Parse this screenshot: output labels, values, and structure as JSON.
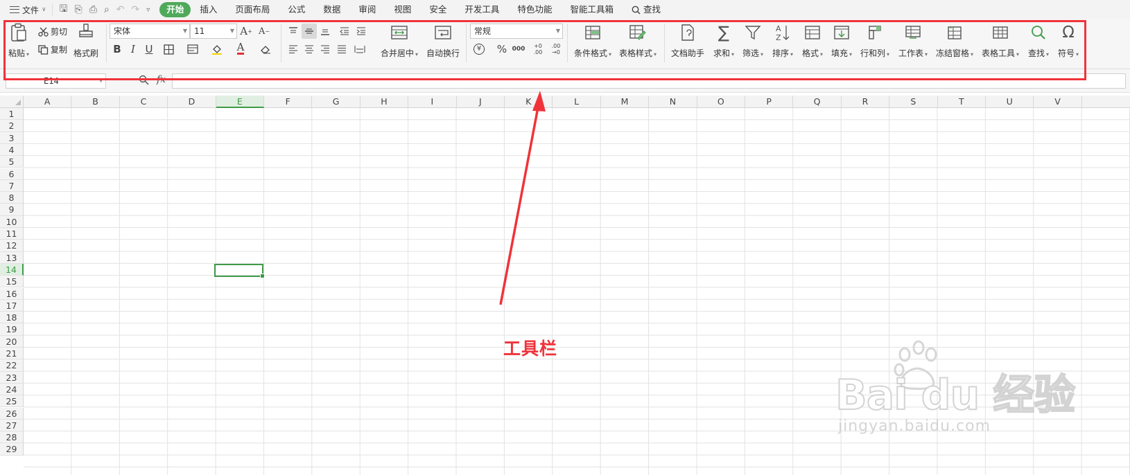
{
  "menubar": {
    "file_label": "文件",
    "tabs": [
      "开始",
      "插入",
      "页面布局",
      "公式",
      "数据",
      "审阅",
      "视图",
      "安全",
      "开发工具",
      "特色功能",
      "智能工具箱"
    ],
    "search_label": "查找"
  },
  "ribbon": {
    "clipboard": {
      "paste": "粘贴",
      "cut": "剪切",
      "copy": "复制",
      "format_painter": "格式刷"
    },
    "font": {
      "font_name": "宋体",
      "font_size": "11",
      "bold": "B",
      "italic": "I",
      "underline": "U",
      "font_color_glyph": "A"
    },
    "alignment": {
      "merge_center": "合并居中",
      "wrap_text": "自动换行"
    },
    "number": {
      "format": "常规",
      "percent": "%",
      "thousands": "000",
      "inc_decimal": "+0 .00",
      "dec_decimal": ".00 →0"
    },
    "styles": {
      "conditional_format": "条件格式",
      "table_style": "表格样式"
    },
    "tools": [
      "文档助手",
      "求和",
      "筛选",
      "排序",
      "格式",
      "填充",
      "行和列",
      "工作表",
      "冻结窗格",
      "表格工具",
      "查找",
      "符号"
    ]
  },
  "formula_bar": {
    "name_box": "E14",
    "fx": "fx",
    "value": ""
  },
  "sheet": {
    "columns": [
      "A",
      "B",
      "C",
      "D",
      "E",
      "F",
      "G",
      "H",
      "I",
      "J",
      "K",
      "L",
      "M",
      "N",
      "O",
      "P",
      "Q",
      "R",
      "S",
      "T",
      "U",
      "V"
    ],
    "rows": [
      "1",
      "2",
      "3",
      "4",
      "5",
      "6",
      "7",
      "8",
      "9",
      "10",
      "11",
      "12",
      "13",
      "14",
      "15",
      "16",
      "17",
      "18",
      "19",
      "20",
      "21",
      "22",
      "23",
      "24",
      "25",
      "26",
      "27",
      "28",
      "29"
    ],
    "active_column": "E",
    "active_row": "14"
  },
  "annotation": {
    "label": "工具栏",
    "color": "#f0333a"
  },
  "watermark": {
    "brand": "Bai du 经验",
    "url": "jingyan.baidu.com"
  },
  "colors": {
    "accent": "#4fa95a",
    "annotation": "#f0333a"
  }
}
